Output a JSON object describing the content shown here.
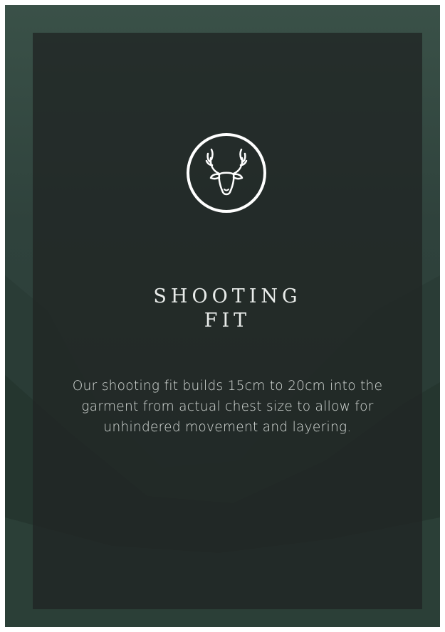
{
  "card": {
    "icon": "stag-head-icon",
    "title_line1": "SHOOTING",
    "title_line2": "FIT",
    "description": "Our shooting fit builds 15cm to 20cm into the garment from actual chest size to allow for unhindered movement and layering."
  },
  "colors": {
    "background": "#2d3f39",
    "panel": "#232927",
    "text": "#e9ecea"
  }
}
